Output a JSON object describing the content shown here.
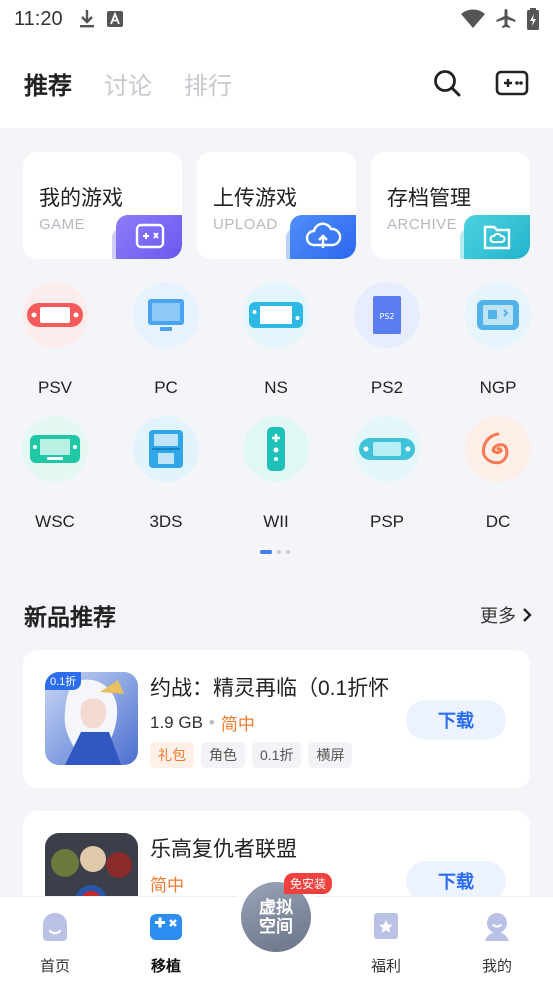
{
  "status": {
    "time": "11:20"
  },
  "top_tabs": [
    {
      "label": "推荐",
      "active": true
    },
    {
      "label": "讨论",
      "active": false
    },
    {
      "label": "排行",
      "active": false
    }
  ],
  "quick_cards": [
    {
      "title": "我的游戏",
      "subtitle": "GAME",
      "icon": "gamepad-icon",
      "color": "#7b6cf6"
    },
    {
      "title": "上传游戏",
      "subtitle": "UPLOAD",
      "icon": "cloud-upload-icon",
      "color": "#3d7cf5"
    },
    {
      "title": "存档管理",
      "subtitle": "ARCHIVE",
      "icon": "folder-icon",
      "color": "#2fc2d6"
    }
  ],
  "platforms": [
    {
      "label": "PSV",
      "icon": "psv-icon",
      "color": "#f65a5a",
      "bg": "#fdecec"
    },
    {
      "label": "PC",
      "icon": "monitor-icon",
      "color": "#4aa3f0",
      "bg": "#e6f2fd"
    },
    {
      "label": "NS",
      "icon": "switch-icon",
      "color": "#2eb8e6",
      "bg": "#e2f6fc"
    },
    {
      "label": "PS2",
      "icon": "ps2-icon",
      "color": "#5a7df2",
      "bg": "#e8edfd"
    },
    {
      "label": "NGP",
      "icon": "ngp-icon",
      "color": "#52b3ea",
      "bg": "#e6f4fc"
    },
    {
      "label": "WSC",
      "icon": "wsc-icon",
      "color": "#20c7a4",
      "bg": "#e3f8f3"
    },
    {
      "label": "3DS",
      "icon": "3ds-icon",
      "color": "#2fa7e8",
      "bg": "#e3f3fc"
    },
    {
      "label": "WII",
      "icon": "wii-remote-icon",
      "color": "#1ec2b8",
      "bg": "#e1f7f6"
    },
    {
      "label": "PSP",
      "icon": "psp-icon",
      "color": "#3ec3d8",
      "bg": "#e3f6f9"
    },
    {
      "label": "DC",
      "icon": "dc-swirl-icon",
      "color": "#f57a52",
      "bg": "#fdeee8"
    }
  ],
  "section": {
    "title": "新品推荐",
    "more": "更多"
  },
  "games": [
    {
      "name": "约战：精灵再临（0.1折怀",
      "size": "1.9 GB",
      "lang": "简中",
      "tags": [
        "礼包",
        "角色",
        "0.1折",
        "横屏"
      ],
      "thumb_badge": "0.1折",
      "button": "下载"
    },
    {
      "name": "乐高复仇者联盟",
      "size": "",
      "lang": "简中",
      "tags": [],
      "button": "下载"
    }
  ],
  "bottom_nav": [
    {
      "label": "首页",
      "icon": "home-icon",
      "active": false
    },
    {
      "label": "移植",
      "icon": "port-gamepad-icon",
      "active": true
    },
    {
      "label": "福利",
      "icon": "welfare-star-icon",
      "active": false
    },
    {
      "label": "我的",
      "icon": "profile-icon",
      "active": false
    }
  ],
  "center_button": {
    "label": "虚拟空间",
    "badge": "免安装"
  }
}
